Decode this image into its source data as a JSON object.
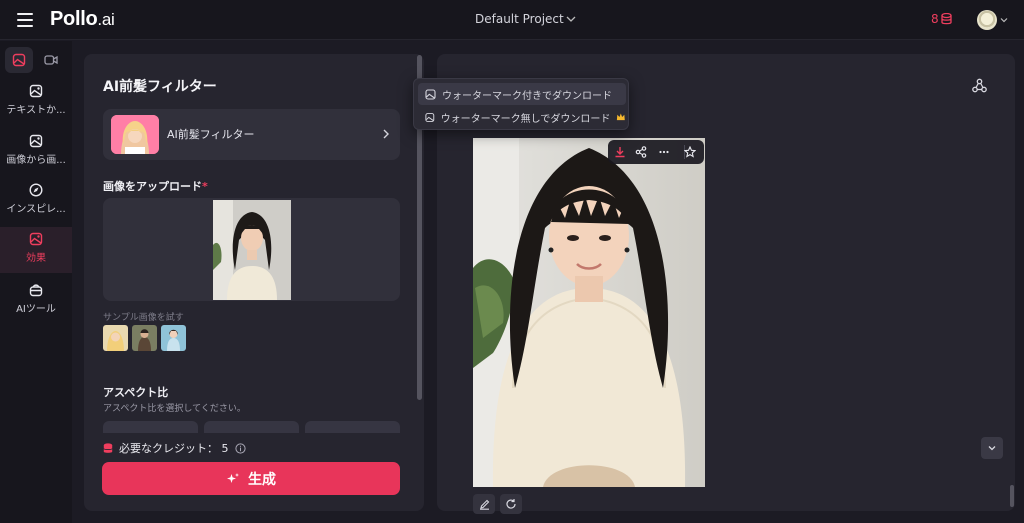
{
  "app": {
    "logo_main": "Pollo",
    "logo_suffix": ".ai"
  },
  "header": {
    "project_name": "Default Project",
    "credits": "8"
  },
  "sidebar": {
    "items": [
      {
        "label": "テキストか..."
      },
      {
        "label": "画像から画..."
      },
      {
        "label": "インスピレ..."
      },
      {
        "label": "効果"
      },
      {
        "label": "AIツール"
      }
    ]
  },
  "left_panel": {
    "title": "AI前髪フィルター",
    "filter_name": "AI前髪フィルター",
    "upload_label": "画像をアップロード",
    "required_mark": "*",
    "sample_label": "サンプル画像を試す",
    "aspect_title": "アスペクト比",
    "aspect_subtitle": "アスペクト比を選択してください。",
    "credits_label": "必要なクレジット： 5",
    "generate_label": "生成"
  },
  "dropdown": {
    "with_watermark": "ウォーターマーク付きでダウンロード",
    "without_watermark": "ウォーターマーク無しでダウンロード"
  },
  "colors": {
    "accent": "#e8355a",
    "panel": "#26252f",
    "background": "#1c1b24"
  }
}
